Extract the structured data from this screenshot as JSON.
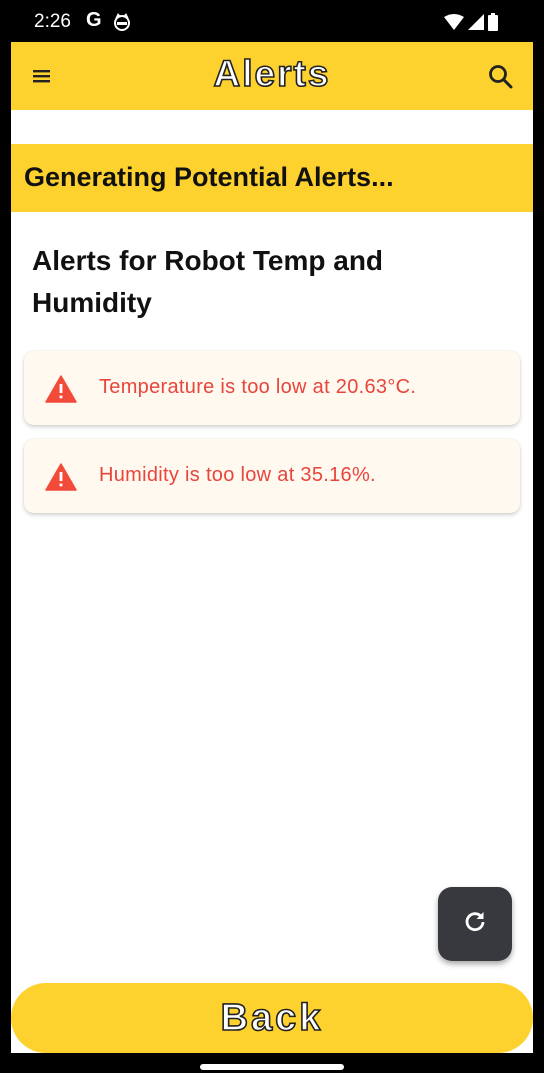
{
  "status_bar": {
    "time": "2:26",
    "google_glyph": "G",
    "icons": [
      "google-icon",
      "cat-icon",
      "wifi-icon",
      "cell-signal-icon",
      "battery-icon"
    ]
  },
  "app_bar": {
    "title": "Alerts",
    "menu_icon": "menu-icon",
    "search_icon": "search-icon"
  },
  "banner": {
    "text": "Generating Potential Alerts..."
  },
  "section": {
    "title": "Alerts for Robot Temp and Humidity"
  },
  "alerts": [
    {
      "icon": "warning-icon",
      "text": "Temperature is too low at 20.63°C."
    },
    {
      "icon": "warning-icon",
      "text": "Humidity is too low at 35.16%."
    }
  ],
  "fab": {
    "icon": "refresh-icon"
  },
  "back_button": {
    "label": "Back"
  },
  "colors": {
    "accent": "#FDD22F",
    "alert_text": "#E8453C",
    "alert_icon": "#F24B3A",
    "card_bg": "#FFF9F0",
    "fab_bg": "#37393F"
  }
}
